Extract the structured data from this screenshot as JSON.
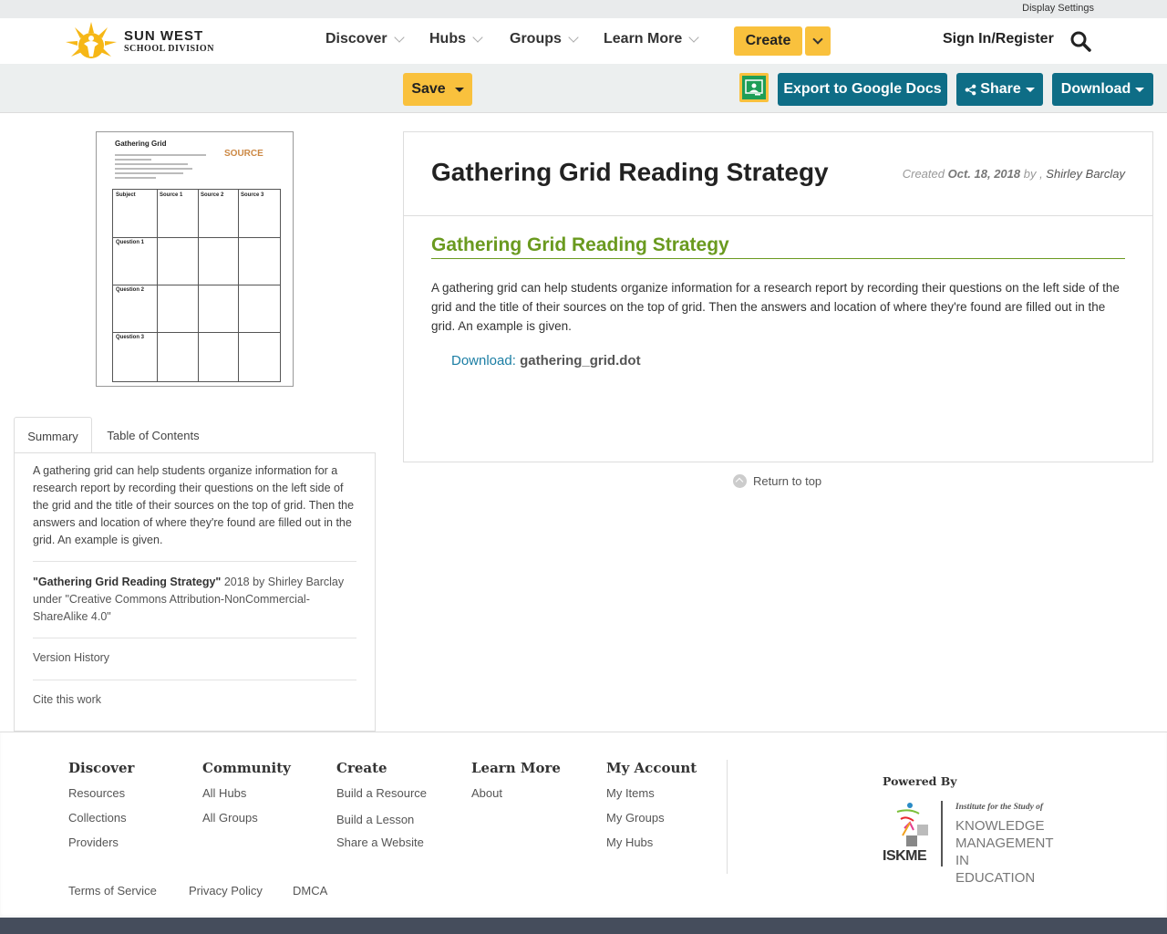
{
  "utility": {
    "display_settings": "Display Settings"
  },
  "brand": {
    "line1": "SUN WEST",
    "line2": "SCHOOL DIVISION"
  },
  "nav": {
    "items": [
      {
        "label": "Discover"
      },
      {
        "label": "Hubs"
      },
      {
        "label": "Groups"
      },
      {
        "label": "Learn More"
      }
    ],
    "create_label": "Create",
    "signin_label": "Sign In/Register"
  },
  "toolbar": {
    "save_label": "Save",
    "export_label": "Export to Google Docs",
    "share_label": "Share",
    "download_label": "Download"
  },
  "thumbnail": {
    "title": "Gathering Grid",
    "source_logo": "SOURCE",
    "columns": [
      "Subject",
      "Source 1",
      "Source 2",
      "Source 3"
    ],
    "rows": [
      "Question 1",
      "Question 2",
      "Question 3"
    ]
  },
  "tabs": [
    {
      "label": "Summary",
      "active": true
    },
    {
      "label": "Table of Contents",
      "active": false
    }
  ],
  "summary": {
    "text": "A gathering grid can help students organize information for a research report by recording their questions on the left side of the grid and the title of their sources on the top of grid. Then the answers and location of where they're found are filled out in the grid. An example is given.",
    "attribution_title": "\"Gathering Grid Reading Strategy\"",
    "attribution_rest": " 2018 by Shirley Barclay under \"Creative Commons Attribution-NonCommercial-ShareAlike 4.0\"",
    "version_history": "Version History",
    "cite": "Cite this work"
  },
  "resource": {
    "title": "Gathering Grid Reading Strategy",
    "created_prefix": "Created ",
    "created_date": "Oct. 18, 2018",
    "created_by": " by , ",
    "author": "Shirley Barclay",
    "section_title": "Gathering Grid Reading Strategy",
    "description": "A gathering grid can help students organize information for a research report by recording their questions on the left side of the grid and the title of their sources on the top of grid.  Then the answers and location of where they're found are filled out in the grid.  An example is given.",
    "download_label": "Download:",
    "download_file": "gathering_grid.dot"
  },
  "return_top": "Return to top",
  "footer": {
    "columns": [
      {
        "head": "Discover",
        "links": [
          "Resources",
          "Collections",
          "Providers"
        ]
      },
      {
        "head": "Community",
        "links": [
          "All Hubs",
          "All Groups"
        ]
      },
      {
        "head": "Create",
        "links": [
          "Build a Resource",
          "Build a Lesson",
          "Share a Website"
        ]
      },
      {
        "head": "Learn More",
        "links": [
          "About"
        ]
      },
      {
        "head": "My Account",
        "links": [
          "My Items",
          "My Groups",
          "My Hubs"
        ]
      }
    ],
    "powered_by": "Powered By",
    "iskme": {
      "acronym": "ISKME",
      "institute": "Institute for the Study of",
      "line1": "KNOWLEDGE",
      "line2": "MANAGEMENT IN",
      "line3": "EDUCATION"
    },
    "legal": [
      "Terms of Service",
      "Privacy Policy",
      "DMCA"
    ]
  },
  "colors": {
    "accent_yellow": "#f9c13d",
    "accent_teal": "#0e6d86",
    "section_green": "#6a9a1f",
    "link_blue": "#1b7ea4",
    "footer_bar": "#454d5c"
  }
}
